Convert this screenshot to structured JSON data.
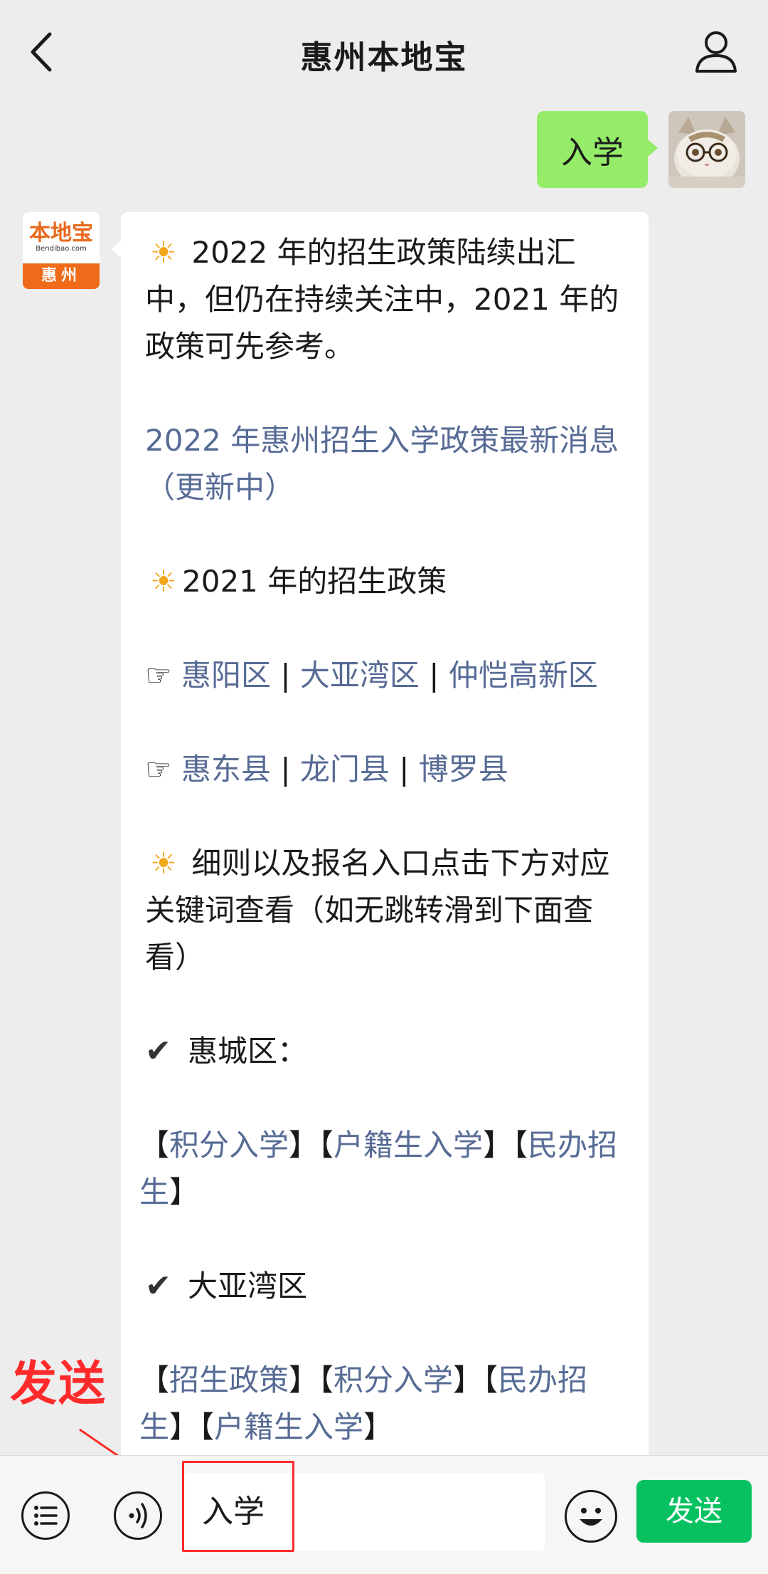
{
  "header": {
    "title": "惠州本地宝"
  },
  "messages": {
    "user_text": "入学",
    "bot_avatar": {
      "logo_text": "本地宝",
      "url_text": "Bendibao.com",
      "city": "惠州"
    }
  },
  "bot": {
    "sun": "☀",
    "hand": "☞",
    "check": "✔",
    "sep": " | ",
    "intro": "2022 年的招生政策陆续出汇中，但仍在持续关注中，2021 年的政策可先参考。",
    "link_2022": "2022 年惠州招生入学政策最新消息（更新中）",
    "heading_2021": "2021 年的招生政策",
    "district_row1": [
      "惠阳区",
      "大亚湾区",
      "仲恺高新区"
    ],
    "district_row2": [
      "惠东县",
      "龙门县",
      "博罗县"
    ],
    "note": "细则以及报名入口点击下方对应关键词查看（如无跳转滑到下面查看）",
    "huicheng_label": "惠城区：",
    "huicheng_links": [
      "积分入学",
      "户籍生入学",
      "民办招生"
    ],
    "dayawan_label": "大亚湾区",
    "dayawan_links": [
      "招生政策",
      "积分入学",
      "民办招生",
      "户籍生入学"
    ]
  },
  "annotation": {
    "text": "发送"
  },
  "input_bar": {
    "input_value": "入学",
    "send_label": "发送"
  },
  "colors": {
    "bubble_me": "#95ec69",
    "link": "#576b95",
    "send": "#07c160",
    "annotation": "#ff2a2a"
  }
}
